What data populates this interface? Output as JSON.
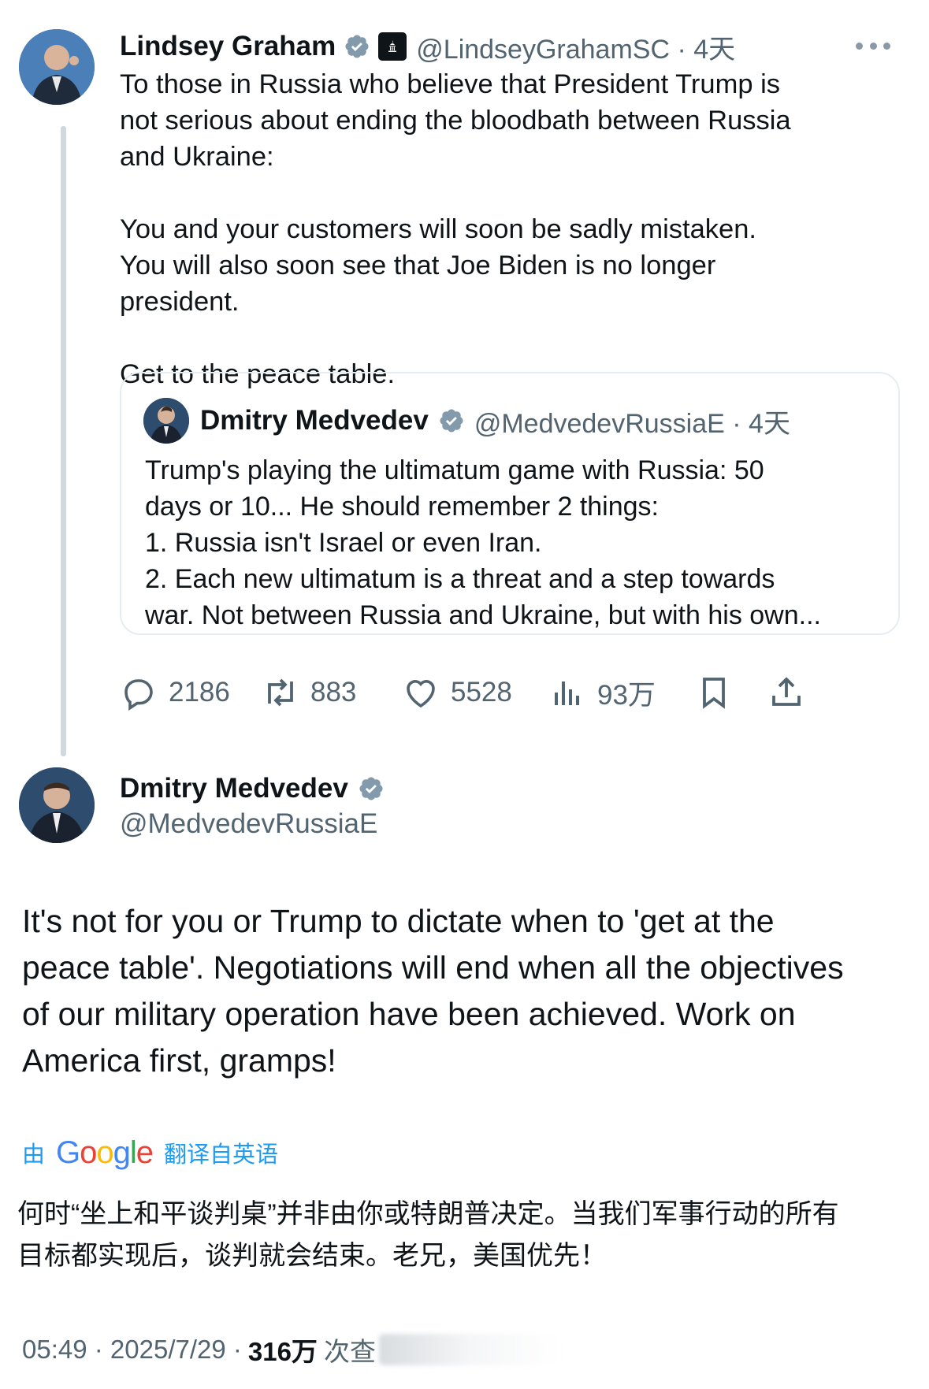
{
  "tweet1": {
    "author_name": "Lindsey Graham",
    "handle_time": "@LindseyGrahamSC · 4天",
    "paragraphs": [
      "To those in Russia who believe that President Trump is not serious about ending the bloodbath between Russia and Ukraine:",
      "You and your customers will soon be sadly mistaken. You will also soon see that Joe Biden is no longer president.",
      "Get to the peace table."
    ],
    "quote": {
      "author_name": "Dmitry Medvedev",
      "handle_time": "@MedvedevRussiaE · 4天",
      "lines": [
        "Trump's playing the ultimatum game with Russia: 50",
        "days or 10... He should remember 2 things:",
        "1. Russia isn't Israel or even Iran.",
        "2. Each new ultimatum is a threat and a step towards",
        "war. Not between Russia and Ukraine, but with his own..."
      ]
    },
    "stats": {
      "replies": "2186",
      "reposts": "883",
      "likes": "5528",
      "views": "93万"
    }
  },
  "tweet2": {
    "author_name": "Dmitry Medvedev",
    "handle": "@MedvedevRussiaE",
    "lines": [
      "It's not for you or Trump to dictate when to 'get at the",
      "peace table'. Negotiations will end when all the objectives",
      "of our military operation have been achieved. Work on",
      "America first, gramps!"
    ],
    "translate_prefix": "由",
    "translate_brand": "Google",
    "translate_suffix": "翻译自英语",
    "translation_lines": [
      "何时“坐上和平谈判桌”并非由你或特朗普决定。当我们军事行动的所有",
      "目标都实现后，谈判就会结束。老兄，美国优先！"
    ],
    "time_date": "05:49 · 2025/7/29 ·",
    "views_count": "316万",
    "views_label": "次查"
  },
  "colors": {
    "verified": "#829aab",
    "link": "#1d9bf0",
    "muted": "#536471",
    "text": "#0f1419"
  },
  "icons": [
    "more-icon",
    "verified-icon",
    "government-icon",
    "reply-icon",
    "repost-icon",
    "like-icon",
    "views-icon",
    "bookmark-icon",
    "share-icon"
  ]
}
